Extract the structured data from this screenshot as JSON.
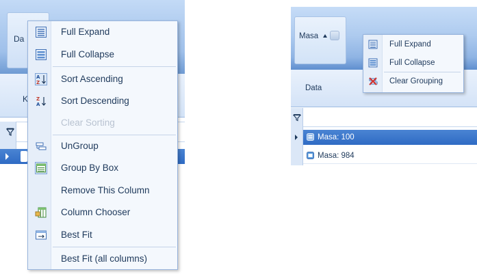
{
  "left": {
    "tab_label": "Da",
    "col_header_label": "K",
    "menu": {
      "items": [
        {
          "label": "Full Expand",
          "icon": "full-expand-icon",
          "enabled": true
        },
        {
          "label": "Full Collapse",
          "icon": "full-collapse-icon",
          "enabled": true
        },
        {
          "label": "Sort Ascending",
          "icon": "sort-ascending-icon",
          "enabled": true
        },
        {
          "label": "Sort Descending",
          "icon": "sort-descending-icon",
          "enabled": true
        },
        {
          "label": "Clear Sorting",
          "icon": "",
          "enabled": false
        },
        {
          "label": "UnGroup",
          "icon": "ungroup-icon",
          "enabled": true
        },
        {
          "label": "Group By Box",
          "icon": "group-by-box-icon",
          "enabled": true
        },
        {
          "label": "Remove This Column",
          "icon": "",
          "enabled": true
        },
        {
          "label": "Column Chooser",
          "icon": "column-chooser-icon",
          "enabled": true
        },
        {
          "label": "Best Fit",
          "icon": "best-fit-icon",
          "enabled": true
        },
        {
          "label": "Best Fit (all columns)",
          "icon": "",
          "enabled": true
        }
      ]
    }
  },
  "right": {
    "tab_label": "Masa",
    "col_header_label": "Data",
    "rows": [
      {
        "text": "Masa: 100",
        "selected": true
      },
      {
        "text": "Masa: 984",
        "selected": false
      }
    ],
    "menu": {
      "items": [
        {
          "label": "Full Expand",
          "icon": "full-expand-icon"
        },
        {
          "label": "Full Collapse",
          "icon": "full-collapse-icon"
        },
        {
          "label": "Clear Grouping",
          "icon": "clear-grouping-icon"
        }
      ]
    }
  },
  "colors": {
    "selection": "#2f6bc4",
    "menu_text": "#1e395b",
    "disabled_text": "#b9c3d1",
    "header_blue": "#aecbef"
  }
}
